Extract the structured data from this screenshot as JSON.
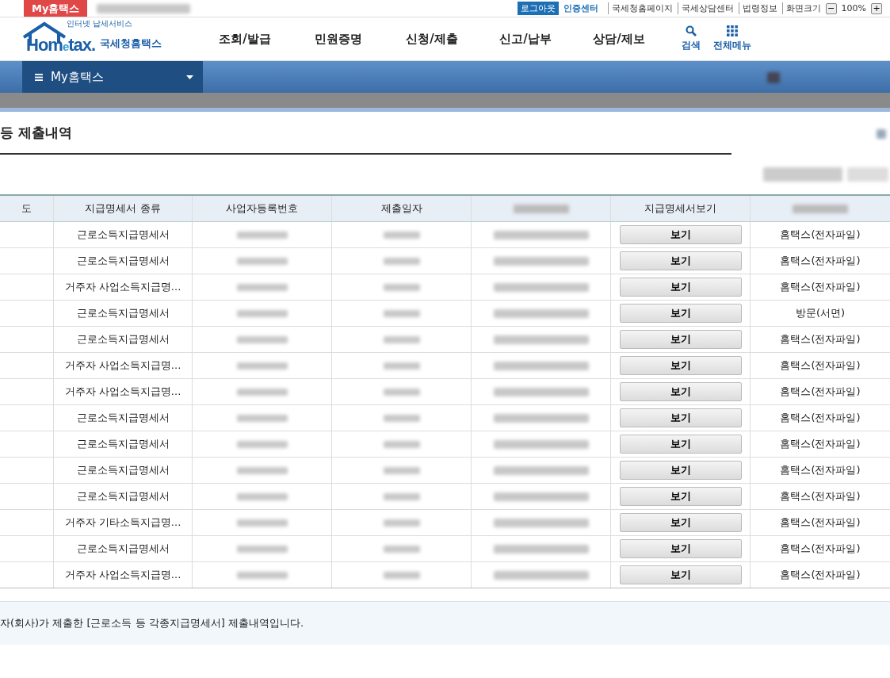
{
  "top_bar": {
    "badge": "My홈택스",
    "logout": "로그아웃",
    "cert": "인증센터",
    "links": [
      "국세청홈페이지",
      "국세상담센터",
      "법령정보"
    ],
    "zoom_label": "화면크기",
    "zoom_out": "−",
    "zoom_value": "100%",
    "zoom_in": "+"
  },
  "header": {
    "logo_tag": "인터넷 납세서비스",
    "logo_word_1": "Hom",
    "logo_word_2": "e",
    "logo_word_3": "tax.",
    "logo_name": "국세청홈택스",
    "menu": [
      "조회/발급",
      "민원증명",
      "신청/제출",
      "신고/납부",
      "상담/제보"
    ],
    "search": "검색",
    "all_menu": "전체메뉴"
  },
  "nav": {
    "title": "My홈택스"
  },
  "page_title": "등 제출내역",
  "table": {
    "columns": [
      "도",
      "지급명세서 종류",
      "사업자등록번호",
      "제출일자",
      null,
      "지급명세서보기",
      null
    ],
    "rows": [
      {
        "type": "근로소득지급명세서",
        "button": "보기",
        "method": "홈택스(전자파일)"
      },
      {
        "type": "근로소득지급명세서",
        "button": "보기",
        "method": "홈택스(전자파일)"
      },
      {
        "type": "거주자 사업소득지급명...",
        "button": "보기",
        "method": "홈택스(전자파일)"
      },
      {
        "type": "근로소득지급명세서",
        "button": "보기",
        "method": "방문(서면)"
      },
      {
        "type": "근로소득지급명세서",
        "button": "보기",
        "method": "홈택스(전자파일)"
      },
      {
        "type": "거주자 사업소득지급명...",
        "button": "보기",
        "method": "홈택스(전자파일)"
      },
      {
        "type": "거주자 사업소득지급명...",
        "button": "보기",
        "method": "홈택스(전자파일)"
      },
      {
        "type": "근로소득지급명세서",
        "button": "보기",
        "method": "홈택스(전자파일)"
      },
      {
        "type": "근로소득지급명세서",
        "button": "보기",
        "method": "홈택스(전자파일)"
      },
      {
        "type": "근로소득지급명세서",
        "button": "보기",
        "method": "홈택스(전자파일)"
      },
      {
        "type": "근로소득지급명세서",
        "button": "보기",
        "method": "홈택스(전자파일)"
      },
      {
        "type": "거주자 기타소득지급명...",
        "button": "보기",
        "method": "홈택스(전자파일)"
      },
      {
        "type": "근로소득지급명세서",
        "button": "보기",
        "method": "홈택스(전자파일)"
      },
      {
        "type": "거주자 사업소득지급명...",
        "button": "보기",
        "method": "홈택스(전자파일)"
      }
    ]
  },
  "note": "자(회사)가 제출한 [근로소득 등 각종지급명세서] 제출내역입니다."
}
